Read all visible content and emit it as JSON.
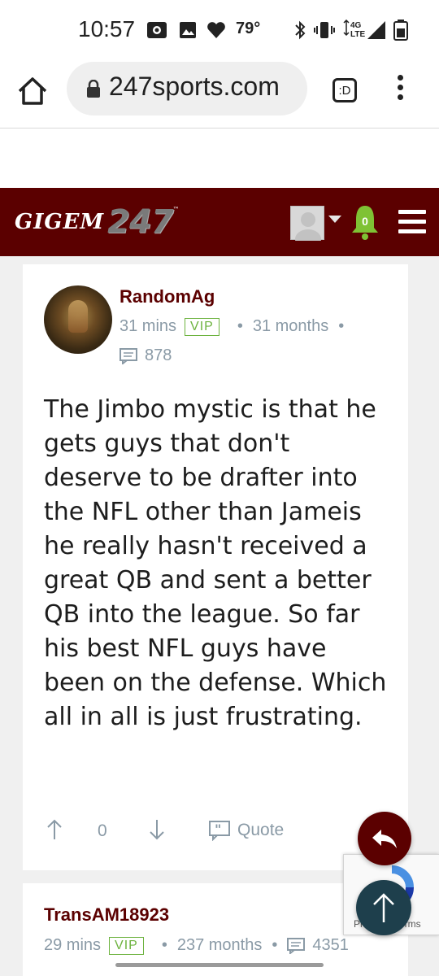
{
  "status_bar": {
    "time": "10:57",
    "temperature": "79°",
    "network_label_top": "4G",
    "network_label_bottom": "LTE"
  },
  "browser": {
    "url": "247sports.com",
    "tab_switcher_label": ":D"
  },
  "site": {
    "logo_text": "GIGEM",
    "logo_number": "247",
    "logo_trademark": "™",
    "notification_count": "0",
    "brand_color": "#5b0000"
  },
  "posts": [
    {
      "username": "RandomAg",
      "time_ago": "31 mins",
      "badge": "VIP",
      "membership": "31 months",
      "post_count": "878",
      "body": "The Jimbo mystic is that he gets guys that don't deserve to be drafter into the NFL other than Jameis he really hasn't received a great QB and sent a better QB into the league. So far his best NFL guys have been on the defense. Which all in all is just frustrating.",
      "votes": "0",
      "quote_label": "Quote"
    },
    {
      "username": "TransAM18923",
      "time_ago": "29 mins",
      "badge": "VIP",
      "membership": "237 months",
      "post_count": "4351"
    }
  ],
  "recaptcha": {
    "text_prefix": "Pr",
    "text_suffix": "erms"
  }
}
